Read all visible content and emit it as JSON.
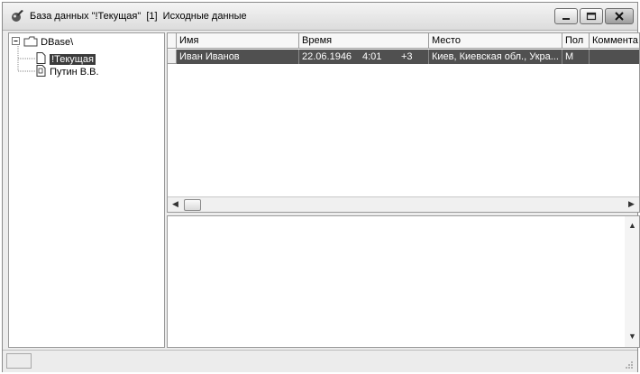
{
  "window": {
    "title": "База данных \"!Текущая\"  [1]  Исходные данные",
    "minimize_icon": "minimize-icon",
    "maximize_icon": "maximize-icon",
    "close_icon": "close-icon"
  },
  "tree": {
    "root": "DBase\\",
    "items": [
      "!Текущая",
      "Путин В.В."
    ],
    "selected": "!Текущая"
  },
  "grid": {
    "columns": [
      "Имя",
      "Время",
      "Место",
      "Пол",
      "Коммента"
    ],
    "rows": [
      {
        "name": "Иван Иванов",
        "date": "22.06.1946",
        "time": "4:01",
        "tz": "+3",
        "place": "Киев, Киевская обл., Укра...",
        "sex": "М",
        "comment": ""
      }
    ]
  },
  "colors": {
    "selection": "#505050",
    "tree_selection": "#3b3b3b"
  }
}
